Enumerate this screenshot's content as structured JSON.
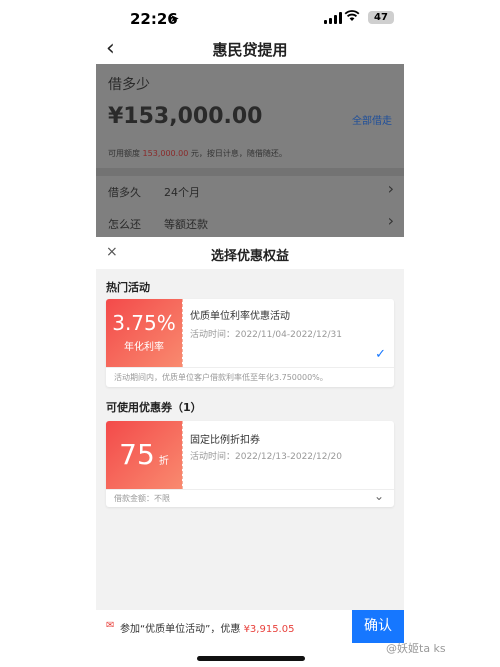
{
  "status": {
    "time": "22:26",
    "battery": "47"
  },
  "nav": {
    "title": "惠民贷提用"
  },
  "loan": {
    "label": "借多少",
    "amount": "¥153,000.00",
    "borrow_all": "全部借走",
    "limit_prefix": "可用额度",
    "limit_value": "153,000.00",
    "limit_suffix": "元，按日计息，随借随还。",
    "term_label": "借多久",
    "term_value": "24个月",
    "repay_label": "怎么还",
    "repay_value": "等额还款"
  },
  "sheet": {
    "title": "选择优惠权益",
    "hot_title": "热门活动",
    "hot_card": {
      "rate": "3.75%",
      "rate_label": "年化利率",
      "name": "优质单位利率优惠活动",
      "time": "活动时间：2022/11/04-2022/12/31",
      "note": "活动期间内，优质单位客户借款利率低至年化3.750000%。"
    },
    "coupon_title": "可使用优惠券（1）",
    "coupon_card": {
      "value": "75",
      "unit": "折",
      "name": "固定比例折扣券",
      "time": "活动时间：2022/12/13-2022/12/20",
      "note": "借款金额：不限"
    }
  },
  "bottom": {
    "text": "参加“优质单位活动”，优惠",
    "discount": "¥3,915.05",
    "confirm": "确认"
  },
  "watermark": "@妖姬ta ks",
  "colors": {
    "accent": "#1677ff",
    "red": "#e8413c"
  }
}
